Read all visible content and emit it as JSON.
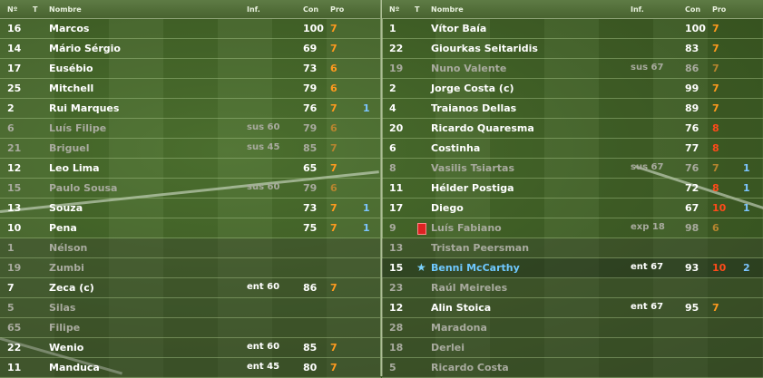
{
  "headers": {
    "no": "Nº",
    "t": "T",
    "name": "Nombre",
    "inf": "Inf.",
    "con": "Con",
    "pro": "Pro"
  },
  "left": [
    {
      "no": "16",
      "name": "Marcos",
      "inf": "",
      "con": "100",
      "pro": "7",
      "pc": "o",
      "x": "",
      "st": "on"
    },
    {
      "no": "14",
      "name": "Mário Sérgio",
      "inf": "",
      "con": "69",
      "pro": "7",
      "pc": "o",
      "x": "",
      "st": "on"
    },
    {
      "no": "17",
      "name": "Eusébio",
      "inf": "",
      "con": "73",
      "pro": "6",
      "pc": "o",
      "x": "",
      "st": "on"
    },
    {
      "no": "25",
      "name": "Mitchell",
      "inf": "",
      "con": "79",
      "pro": "6",
      "pc": "o",
      "x": "",
      "st": "on"
    },
    {
      "no": "2",
      "name": "Rui Marques",
      "inf": "",
      "con": "76",
      "pro": "7",
      "pc": "o",
      "x": "1",
      "st": "on"
    },
    {
      "no": "6",
      "name": "Luís Filipe",
      "inf": "sus 60",
      "con": "79",
      "pro": "6",
      "pc": "o",
      "x": "",
      "st": "dim"
    },
    {
      "no": "21",
      "name": "Briguel",
      "inf": "sus 45",
      "con": "85",
      "pro": "7",
      "pc": "o",
      "x": "",
      "st": "dim"
    },
    {
      "no": "12",
      "name": "Leo Lima",
      "inf": "",
      "con": "65",
      "pro": "7",
      "pc": "o",
      "x": "",
      "st": "on"
    },
    {
      "no": "15",
      "name": "Paulo Sousa",
      "inf": "sus 60",
      "con": "79",
      "pro": "6",
      "pc": "o",
      "x": "",
      "st": "dim"
    },
    {
      "no": "13",
      "name": "Souza",
      "inf": "",
      "con": "73",
      "pro": "7",
      "pc": "o",
      "x": "1",
      "st": "on"
    },
    {
      "no": "10",
      "name": "Pena",
      "inf": "",
      "con": "75",
      "pro": "7",
      "pc": "o",
      "x": "1",
      "st": "on"
    },
    {
      "no": "1",
      "name": "Nélson",
      "inf": "",
      "con": "",
      "pro": "",
      "pc": "",
      "x": "",
      "st": "subdim"
    },
    {
      "no": "19",
      "name": "Zumbi",
      "inf": "",
      "con": "",
      "pro": "",
      "pc": "",
      "x": "",
      "st": "subdim"
    },
    {
      "no": "7",
      "name": "Zeca (c)",
      "inf": "ent 60",
      "con": "86",
      "pro": "7",
      "pc": "o",
      "x": "",
      "st": "sub"
    },
    {
      "no": "5",
      "name": "Silas",
      "inf": "",
      "con": "",
      "pro": "",
      "pc": "",
      "x": "",
      "st": "subdim"
    },
    {
      "no": "65",
      "name": "Filipe",
      "inf": "",
      "con": "",
      "pro": "",
      "pc": "",
      "x": "",
      "st": "subdim"
    },
    {
      "no": "22",
      "name": "Wenio",
      "inf": "ent 60",
      "con": "85",
      "pro": "7",
      "pc": "o",
      "x": "",
      "st": "sub"
    },
    {
      "no": "11",
      "name": "Manduca",
      "inf": "ent 45",
      "con": "80",
      "pro": "7",
      "pc": "o",
      "x": "",
      "st": "sub"
    }
  ],
  "right": [
    {
      "no": "1",
      "name": "Vítor Baía",
      "inf": "",
      "con": "100",
      "pro": "7",
      "pc": "o",
      "x": "",
      "st": "on",
      "icon": ""
    },
    {
      "no": "22",
      "name": "Giourkas Seitaridis",
      "inf": "",
      "con": "83",
      "pro": "7",
      "pc": "o",
      "x": "",
      "st": "on",
      "icon": ""
    },
    {
      "no": "19",
      "name": "Nuno Valente",
      "inf": "sus 67",
      "con": "86",
      "pro": "7",
      "pc": "o",
      "x": "",
      "st": "dim",
      "icon": ""
    },
    {
      "no": "2",
      "name": "Jorge Costa (c)",
      "inf": "",
      "con": "99",
      "pro": "7",
      "pc": "o",
      "x": "",
      "st": "on",
      "icon": ""
    },
    {
      "no": "4",
      "name": "Traianos Dellas",
      "inf": "",
      "con": "89",
      "pro": "7",
      "pc": "o",
      "x": "",
      "st": "on",
      "icon": ""
    },
    {
      "no": "20",
      "name": "Ricardo Quaresma",
      "inf": "",
      "con": "76",
      "pro": "8",
      "pc": "r",
      "x": "",
      "st": "on",
      "icon": ""
    },
    {
      "no": "6",
      "name": "Costinha",
      "inf": "",
      "con": "77",
      "pro": "8",
      "pc": "r",
      "x": "",
      "st": "on",
      "icon": ""
    },
    {
      "no": "8",
      "name": "Vasilis Tsiartas",
      "inf": "sus 67",
      "con": "76",
      "pro": "7",
      "pc": "o",
      "x": "1",
      "st": "dim",
      "icon": ""
    },
    {
      "no": "11",
      "name": "Hélder Postiga",
      "inf": "",
      "con": "72",
      "pro": "8",
      "pc": "r",
      "x": "1",
      "st": "on",
      "icon": ""
    },
    {
      "no": "17",
      "name": "Diego",
      "inf": "",
      "con": "67",
      "pro": "10",
      "pc": "r",
      "x": "1",
      "st": "on",
      "icon": ""
    },
    {
      "no": "9",
      "name": "Luís Fabiano",
      "inf": "exp 18",
      "con": "98",
      "pro": "6",
      "pc": "o",
      "x": "",
      "st": "dim",
      "icon": "card"
    },
    {
      "no": "13",
      "name": "Tristan Peersman",
      "inf": "",
      "con": "",
      "pro": "",
      "pc": "",
      "x": "",
      "st": "subdim",
      "icon": ""
    },
    {
      "no": "15",
      "name": "Benni McCarthy",
      "inf": "ent 67",
      "con": "93",
      "pro": "10",
      "pc": "r",
      "x": "2",
      "st": "selhl",
      "icon": "star"
    },
    {
      "no": "23",
      "name": "Raúl Meireles",
      "inf": "",
      "con": "",
      "pro": "",
      "pc": "",
      "x": "",
      "st": "subdim",
      "icon": ""
    },
    {
      "no": "12",
      "name": "Alin Stoica",
      "inf": "ent 67",
      "con": "95",
      "pro": "7",
      "pc": "o",
      "x": "",
      "st": "sub",
      "icon": ""
    },
    {
      "no": "28",
      "name": "Maradona",
      "inf": "",
      "con": "",
      "pro": "",
      "pc": "",
      "x": "",
      "st": "subdim",
      "icon": ""
    },
    {
      "no": "18",
      "name": "Derlei",
      "inf": "",
      "con": "",
      "pro": "",
      "pc": "",
      "x": "",
      "st": "subdim",
      "icon": ""
    },
    {
      "no": "5",
      "name": "Ricardo Costa",
      "inf": "",
      "con": "",
      "pro": "",
      "pc": "",
      "x": "",
      "st": "subdim",
      "icon": ""
    }
  ]
}
